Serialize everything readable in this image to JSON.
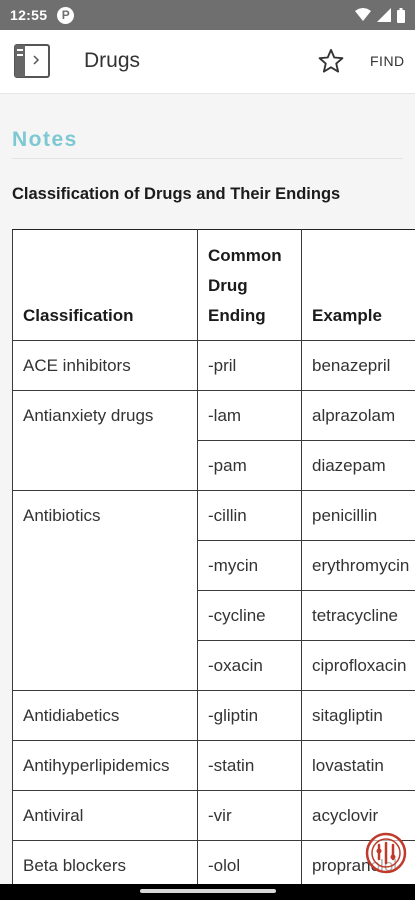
{
  "status": {
    "time": "12:55",
    "indicator": "P"
  },
  "appbar": {
    "title": "Drugs",
    "find_label": "FIND"
  },
  "notes": {
    "heading": "Notes",
    "section_title": "Classification of Drugs and Their Endings"
  },
  "table": {
    "headers": [
      "Classification",
      "Common Drug Ending",
      "Example"
    ],
    "header_lines": {
      "c2": [
        "Common",
        "Drug",
        "Ending"
      ]
    },
    "groups": [
      {
        "classification": "ACE inhibitors",
        "rows": [
          {
            "ending": "-pril",
            "example": "benazepril"
          }
        ]
      },
      {
        "classification": "Antianxiety drugs",
        "rows": [
          {
            "ending": "-lam",
            "example": "alprazolam"
          },
          {
            "ending": "-pam",
            "example": "diazepam"
          }
        ]
      },
      {
        "classification": "Antibiotics",
        "rows": [
          {
            "ending": "-cillin",
            "example": "penicillin"
          },
          {
            "ending": "-mycin",
            "example": "erythromycin"
          },
          {
            "ending": "-cycline",
            "example": "tetracycline"
          },
          {
            "ending": "-oxacin",
            "example": "ciprofloxacin"
          }
        ]
      },
      {
        "classification": "Antidiabetics",
        "rows": [
          {
            "ending": "-gliptin",
            "example": "sitagliptin"
          }
        ]
      },
      {
        "classification": "Antihyperlipidemics",
        "rows": [
          {
            "ending": "-statin",
            "example": "lovastatin"
          }
        ]
      },
      {
        "classification": "Antiviral",
        "rows": [
          {
            "ending": "-vir",
            "example": "acyclovir"
          }
        ]
      },
      {
        "classification": "Beta blockers",
        "rows": [
          {
            "ending": "-olol",
            "example": "propranolol"
          }
        ]
      }
    ]
  },
  "icons": {
    "app": "book-icon",
    "favorite": "star-icon",
    "fab": "interaction-icon"
  },
  "colors": {
    "accent": "#7ec8d3",
    "fab": "#c0392b",
    "statusbar": "#6f6f6f"
  }
}
